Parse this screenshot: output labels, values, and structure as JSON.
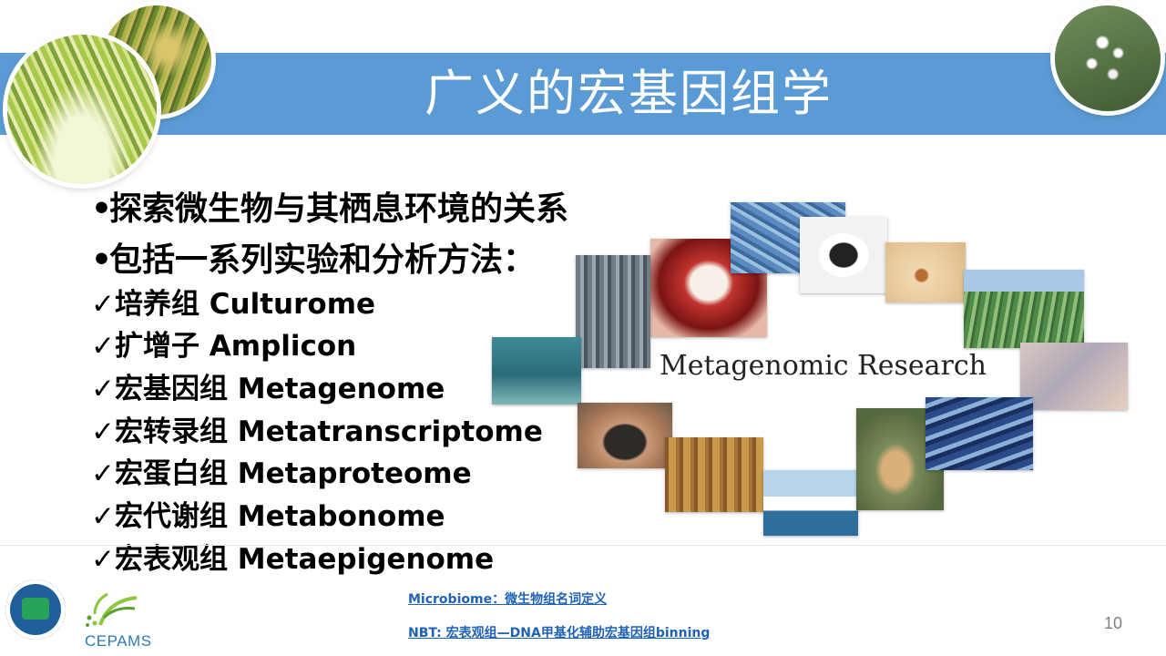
{
  "slide": {
    "title": "广义的宏基因组学",
    "page_number": "10"
  },
  "bullets": [
    "探索微生物与其栖息环境的关系",
    "包括一系列实验和分析方法："
  ],
  "bullet_marker": "•",
  "check_marker": "✓",
  "checklist": [
    "培养组 Culturome",
    "扩增子 Amplicon",
    "宏基因组 Metagenome",
    "宏转录组 Metatranscriptome",
    "宏蛋白组 Metaproteome",
    "宏代谢组 Metabonome",
    "宏表观组 Metaepigenome"
  ],
  "collage": {
    "label": "Metagenomic Research"
  },
  "footer": {
    "links": [
      "Microbiome：微生物组名词定义",
      "NBT: 宏表观组—DNA甲基化辅助宏基因组binning"
    ],
    "logo_text": "CEPAMS"
  },
  "colors": {
    "title_bar": "#5b9bd5",
    "link": "#1f62b6",
    "page_number": "#808080"
  }
}
